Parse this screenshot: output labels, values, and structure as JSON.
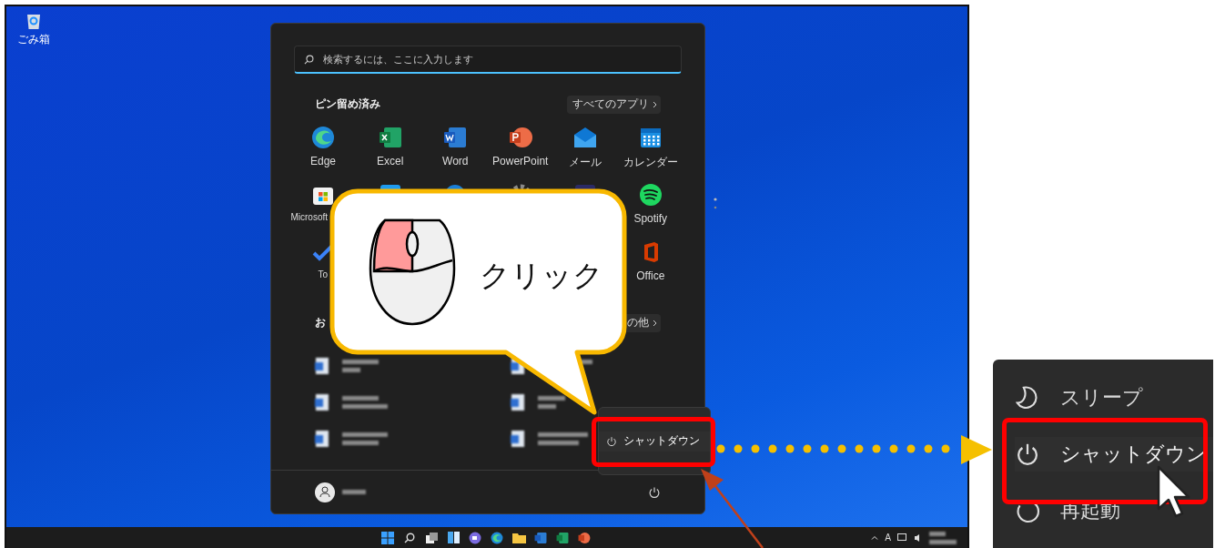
{
  "desktop": {
    "icons": [
      {
        "label": "ごみ箱"
      }
    ]
  },
  "start_menu": {
    "search": {
      "placeholder": "検索するには、ここに入力します"
    },
    "pinned": {
      "title": "ピン留め済み",
      "button": "すべてのアプリ",
      "rows": [
        [
          {
            "kind": "edge",
            "label": "Edge"
          },
          {
            "kind": "excel",
            "label": "Excel"
          },
          {
            "kind": "word",
            "label": "Word"
          },
          {
            "kind": "powerpoint",
            "label": "PowerPoint"
          },
          {
            "kind": "mail",
            "label": "メール"
          },
          {
            "kind": "calendar",
            "label": "カレンダー"
          }
        ],
        [
          {
            "kind": "store",
            "label": "Microsoft"
          },
          {
            "kind": "blue-tile"
          },
          {
            "kind": "blue-circle"
          },
          {
            "kind": "gear"
          },
          {
            "kind": "dark-tile"
          },
          {
            "kind": "spotify",
            "label": "Spotify"
          }
        ],
        [
          {
            "kind": "todo",
            "label": "To"
          },
          "",
          "",
          "",
          "",
          {
            "kind": "office",
            "label": "Office"
          }
        ]
      ]
    },
    "recommended": {
      "title": "お",
      "button": "の他"
    },
    "power_menu": {
      "items": [
        {
          "label": "シャットダウン",
          "selected": true
        }
      ]
    }
  },
  "callout": {
    "text": "クリック"
  },
  "taskbar": {
    "tray_text": "A"
  },
  "inset": {
    "items": [
      {
        "kind": "sleep",
        "label": "スリープ",
        "selected": false
      },
      {
        "kind": "power",
        "label": "シャットダウン",
        "selected": true
      },
      {
        "kind": "restart",
        "label": "再起動",
        "selected": false
      }
    ]
  }
}
